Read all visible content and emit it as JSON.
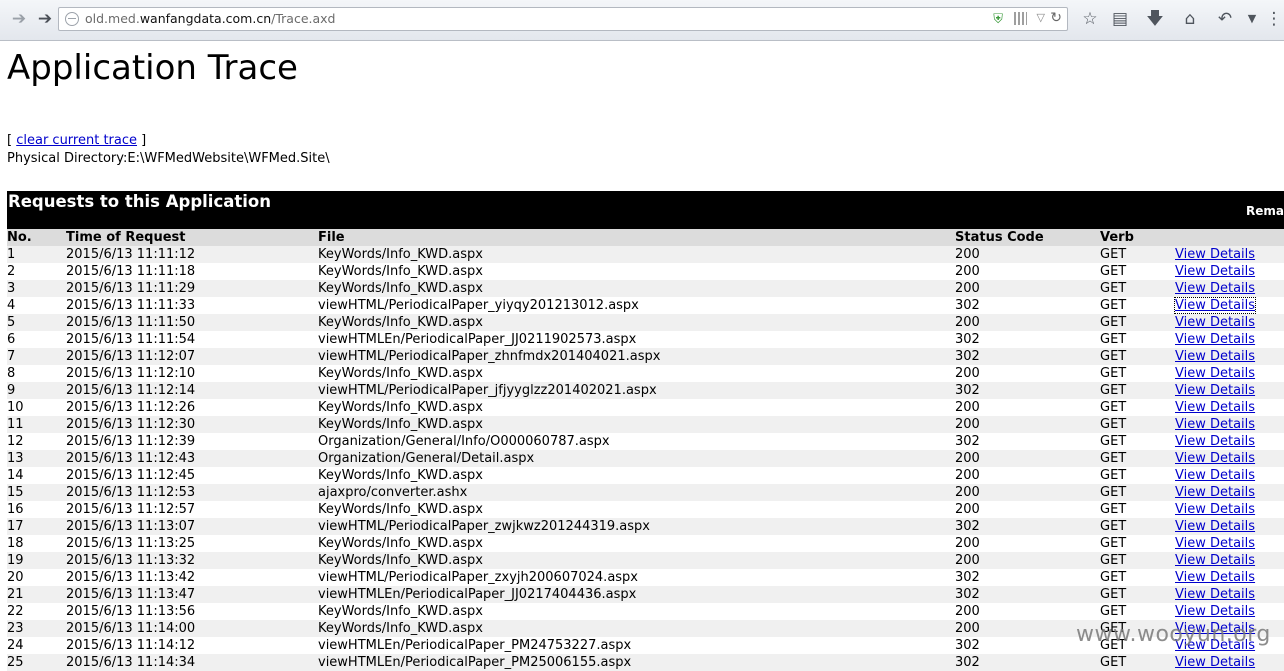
{
  "browser": {
    "url_prefix": "old.med.",
    "url_domain": "wanfangdata.com.cn",
    "url_path": "/Trace.axd"
  },
  "page": {
    "title": "Application Trace",
    "clear_prefix": "[ ",
    "clear_link": "clear current trace",
    "clear_suffix": " ]",
    "physical_directory": "Physical Directory:E:\\WFMedWebsite\\WFMed.Site\\",
    "section_title": "Requests to this Application",
    "remaining_label": "Rema"
  },
  "table": {
    "headers": [
      "No.",
      "Time of Request",
      "File",
      "Status Code",
      "Verb",
      ""
    ],
    "details_label": "View Details",
    "rows": [
      {
        "no": "1",
        "time": "2015/6/13 11:11:12",
        "file": "KeyWords/Info_KWD.aspx",
        "status": "200",
        "verb": "GET"
      },
      {
        "no": "2",
        "time": "2015/6/13 11:11:18",
        "file": "KeyWords/Info_KWD.aspx",
        "status": "200",
        "verb": "GET"
      },
      {
        "no": "3",
        "time": "2015/6/13 11:11:29",
        "file": "KeyWords/Info_KWD.aspx",
        "status": "200",
        "verb": "GET"
      },
      {
        "no": "4",
        "time": "2015/6/13 11:11:33",
        "file": "viewHTML/PeriodicalPaper_yiyqy201213012.aspx",
        "status": "302",
        "verb": "GET"
      },
      {
        "no": "5",
        "time": "2015/6/13 11:11:50",
        "file": "KeyWords/Info_KWD.aspx",
        "status": "200",
        "verb": "GET"
      },
      {
        "no": "6",
        "time": "2015/6/13 11:11:54",
        "file": "viewHTMLEn/PeriodicalPaper_JJ0211902573.aspx",
        "status": "302",
        "verb": "GET"
      },
      {
        "no": "7",
        "time": "2015/6/13 11:12:07",
        "file": "viewHTML/PeriodicalPaper_zhnfmdx201404021.aspx",
        "status": "302",
        "verb": "GET"
      },
      {
        "no": "8",
        "time": "2015/6/13 11:12:10",
        "file": "KeyWords/Info_KWD.aspx",
        "status": "200",
        "verb": "GET"
      },
      {
        "no": "9",
        "time": "2015/6/13 11:12:14",
        "file": "viewHTML/PeriodicalPaper_jfjyyglzz201402021.aspx",
        "status": "302",
        "verb": "GET"
      },
      {
        "no": "10",
        "time": "2015/6/13 11:12:26",
        "file": "KeyWords/Info_KWD.aspx",
        "status": "200",
        "verb": "GET"
      },
      {
        "no": "11",
        "time": "2015/6/13 11:12:30",
        "file": "KeyWords/Info_KWD.aspx",
        "status": "200",
        "verb": "GET"
      },
      {
        "no": "12",
        "time": "2015/6/13 11:12:39",
        "file": "Organization/General/Info/O000060787.aspx",
        "status": "302",
        "verb": "GET"
      },
      {
        "no": "13",
        "time": "2015/6/13 11:12:43",
        "file": "Organization/General/Detail.aspx",
        "status": "200",
        "verb": "GET"
      },
      {
        "no": "14",
        "time": "2015/6/13 11:12:45",
        "file": "KeyWords/Info_KWD.aspx",
        "status": "200",
        "verb": "GET"
      },
      {
        "no": "15",
        "time": "2015/6/13 11:12:53",
        "file": "ajaxpro/converter.ashx",
        "status": "200",
        "verb": "GET"
      },
      {
        "no": "16",
        "time": "2015/6/13 11:12:57",
        "file": "KeyWords/Info_KWD.aspx",
        "status": "200",
        "verb": "GET"
      },
      {
        "no": "17",
        "time": "2015/6/13 11:13:07",
        "file": "viewHTML/PeriodicalPaper_zwjkwz201244319.aspx",
        "status": "302",
        "verb": "GET"
      },
      {
        "no": "18",
        "time": "2015/6/13 11:13:25",
        "file": "KeyWords/Info_KWD.aspx",
        "status": "200",
        "verb": "GET"
      },
      {
        "no": "19",
        "time": "2015/6/13 11:13:32",
        "file": "KeyWords/Info_KWD.aspx",
        "status": "200",
        "verb": "GET"
      },
      {
        "no": "20",
        "time": "2015/6/13 11:13:42",
        "file": "viewHTML/PeriodicalPaper_zxyjh200607024.aspx",
        "status": "302",
        "verb": "GET"
      },
      {
        "no": "21",
        "time": "2015/6/13 11:13:47",
        "file": "viewHTMLEn/PeriodicalPaper_JJ0217404436.aspx",
        "status": "302",
        "verb": "GET"
      },
      {
        "no": "22",
        "time": "2015/6/13 11:13:56",
        "file": "KeyWords/Info_KWD.aspx",
        "status": "200",
        "verb": "GET"
      },
      {
        "no": "23",
        "time": "2015/6/13 11:14:00",
        "file": "KeyWords/Info_KWD.aspx",
        "status": "200",
        "verb": "GET"
      },
      {
        "no": "24",
        "time": "2015/6/13 11:14:12",
        "file": "viewHTMLEn/PeriodicalPaper_PM24753227.aspx",
        "status": "302",
        "verb": "GET"
      },
      {
        "no": "25",
        "time": "2015/6/13 11:14:34",
        "file": "viewHTMLEn/PeriodicalPaper_PM25006155.aspx",
        "status": "302",
        "verb": "GET"
      }
    ]
  },
  "watermark": "www.wooyun.org"
}
